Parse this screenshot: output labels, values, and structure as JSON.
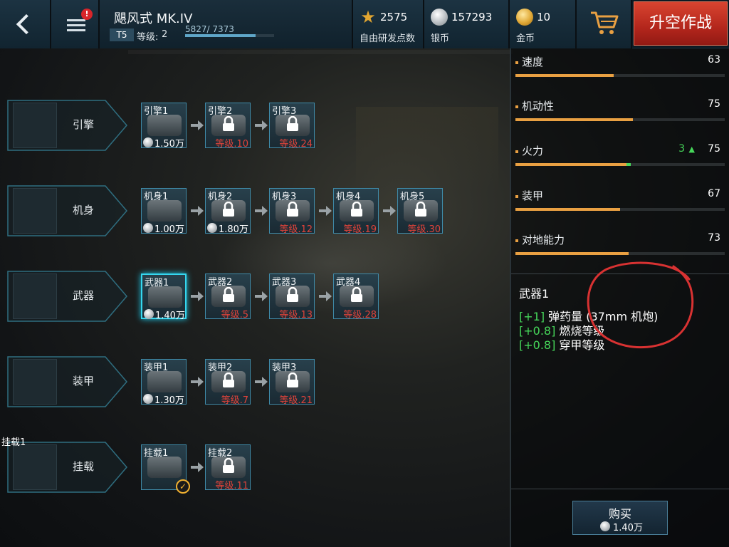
{
  "topbar": {
    "plane_name": "飓风式 MK.IV",
    "tier": "T5",
    "level_label": "等级:",
    "level_value": "2",
    "xp_text": "5827/ 7373",
    "xp_fraction": 0.79,
    "notification_badge": "!",
    "research_points": {
      "value": "2575",
      "label": "自由研发点数",
      "icon": "star-icon"
    },
    "silver": {
      "value": "157293",
      "label": "银币",
      "icon": "silver-coin-icon"
    },
    "gold": {
      "value": "10",
      "label": "金币",
      "icon": "gold-coin-icon"
    },
    "takeoff_label": "升空作战"
  },
  "tree": {
    "rows": [
      {
        "label": "引擎",
        "extra": "",
        "parts": [
          {
            "name": "引擎1",
            "cost": "1.50万",
            "locked": false,
            "req": ""
          },
          {
            "name": "引擎2",
            "cost": "",
            "locked": true,
            "req": "等级.10"
          },
          {
            "name": "引擎3",
            "cost": "",
            "locked": true,
            "req": "等级.24"
          }
        ]
      },
      {
        "label": "机身",
        "extra": "",
        "parts": [
          {
            "name": "机身1",
            "cost": "1.00万",
            "locked": false,
            "req": ""
          },
          {
            "name": "机身2",
            "cost": "1.80万",
            "locked": true,
            "req": ""
          },
          {
            "name": "机身3",
            "cost": "",
            "locked": true,
            "req": "等级.12"
          },
          {
            "name": "机身4",
            "cost": "",
            "locked": true,
            "req": "等级.19"
          },
          {
            "name": "机身5",
            "cost": "",
            "locked": true,
            "req": "等级.30"
          }
        ]
      },
      {
        "label": "武器",
        "extra": "",
        "parts": [
          {
            "name": "武器1",
            "cost": "1.40万",
            "locked": false,
            "req": "",
            "selected": true
          },
          {
            "name": "武器2",
            "cost": "",
            "locked": true,
            "req": "等级.5"
          },
          {
            "name": "武器3",
            "cost": "",
            "locked": true,
            "req": "等级.13"
          },
          {
            "name": "武器4",
            "cost": "",
            "locked": true,
            "req": "等级.28"
          }
        ]
      },
      {
        "label": "装甲",
        "extra": "",
        "parts": [
          {
            "name": "装甲1",
            "cost": "1.30万",
            "locked": false,
            "req": ""
          },
          {
            "name": "装甲2",
            "cost": "",
            "locked": true,
            "req": "等级.7"
          },
          {
            "name": "装甲3",
            "cost": "",
            "locked": true,
            "req": "等级.21"
          }
        ]
      },
      {
        "label": "挂载",
        "extra": "挂载1",
        "parts": [
          {
            "name": "挂载1",
            "cost": "",
            "locked": false,
            "req": "",
            "equipped": true
          },
          {
            "name": "挂载2",
            "cost": "",
            "locked": true,
            "req": "等级.11"
          }
        ]
      }
    ]
  },
  "stats": [
    {
      "name": "速度",
      "value": "63",
      "fraction": 0.47,
      "bonus": "",
      "bonus_fraction": 0
    },
    {
      "name": "机动性",
      "value": "75",
      "fraction": 0.56,
      "bonus": "",
      "bonus_fraction": 0
    },
    {
      "name": "火力",
      "value": "75",
      "fraction": 0.53,
      "bonus": "3",
      "bonus_fraction": 0.02
    },
    {
      "name": "装甲",
      "value": "67",
      "fraction": 0.5,
      "bonus": "",
      "bonus_fraction": 0
    },
    {
      "name": "对地能力",
      "value": "73",
      "fraction": 0.54,
      "bonus": "",
      "bonus_fraction": 0
    }
  ],
  "detail": {
    "title": "武器1",
    "lines": [
      {
        "tag": "[+1]",
        "text": " 弹药量 (37mm 机炮)"
      },
      {
        "tag": "[+0.8]",
        "text": " 燃烧等级"
      },
      {
        "tag": "[+0.8]",
        "text": " 穿甲等级"
      }
    ]
  },
  "buy": {
    "label": "购买",
    "price": "1.40万"
  },
  "colors": {
    "accent": "#35d7f0",
    "stat_bar": "#e9a042",
    "bonus": "#46d75a",
    "lock_req": "#e0433a",
    "takeoff": "#c63323"
  }
}
